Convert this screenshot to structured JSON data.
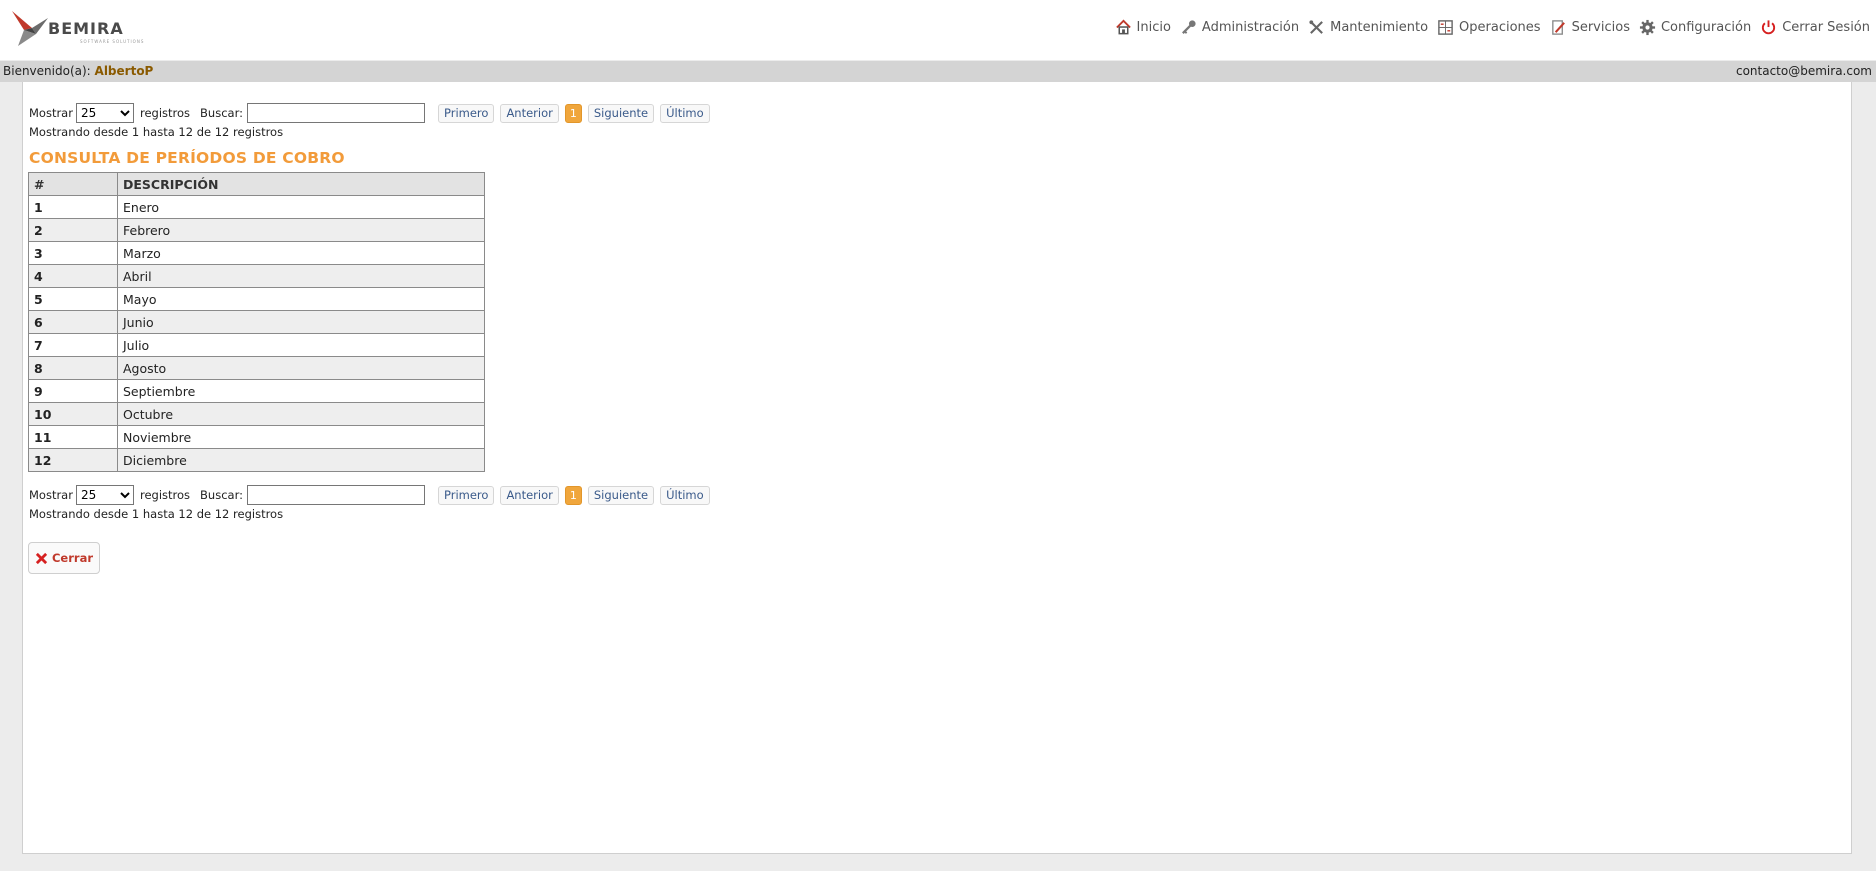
{
  "brand": {
    "name": "BEMIRA",
    "tagline": "SOFTWARE SOLUTIONS"
  },
  "nav": [
    {
      "label": "Inicio",
      "icon": "home-icon"
    },
    {
      "label": "Administración",
      "icon": "key-icon"
    },
    {
      "label": "Mantenimiento",
      "icon": "tools-icon"
    },
    {
      "label": "Operaciones",
      "icon": "calculator-icon"
    },
    {
      "label": "Servicios",
      "icon": "edit-icon"
    },
    {
      "label": "Configuración",
      "icon": "gear-icon"
    },
    {
      "label": "Cerrar Sesión",
      "icon": "power-icon"
    }
  ],
  "welcome": {
    "prefix": "Bienvenido(a):",
    "user": "AlbertoP",
    "contact": "contacto@bemira.com"
  },
  "controls": {
    "show_label": "Mostrar",
    "page_size": "25",
    "records_label": "registros",
    "search_label": "Buscar:",
    "search_value": "",
    "first": "Primero",
    "previous": "Anterior",
    "current_page": "1",
    "next": "Siguiente",
    "last": "Último",
    "info": "Mostrando desde 1 hasta 12 de 12 registros"
  },
  "page_title": "CONSULTA DE PERÍODOS DE COBRO",
  "table": {
    "headers": [
      "#",
      "DESCRIPCIÓN"
    ],
    "rows": [
      {
        "num": "1",
        "desc": "Enero"
      },
      {
        "num": "2",
        "desc": "Febrero"
      },
      {
        "num": "3",
        "desc": "Marzo"
      },
      {
        "num": "4",
        "desc": "Abril"
      },
      {
        "num": "5",
        "desc": "Mayo"
      },
      {
        "num": "6",
        "desc": "Junio"
      },
      {
        "num": "7",
        "desc": "Julio"
      },
      {
        "num": "8",
        "desc": "Agosto"
      },
      {
        "num": "9",
        "desc": "Septiembre"
      },
      {
        "num": "10",
        "desc": "Octubre"
      },
      {
        "num": "11",
        "desc": "Noviembre"
      },
      {
        "num": "12",
        "desc": "Diciembre"
      }
    ]
  },
  "close_button": "Cerrar",
  "colors": {
    "accent": "#f29b3a",
    "welcome_bar": "#d4d4d4",
    "danger": "#c0392b"
  }
}
